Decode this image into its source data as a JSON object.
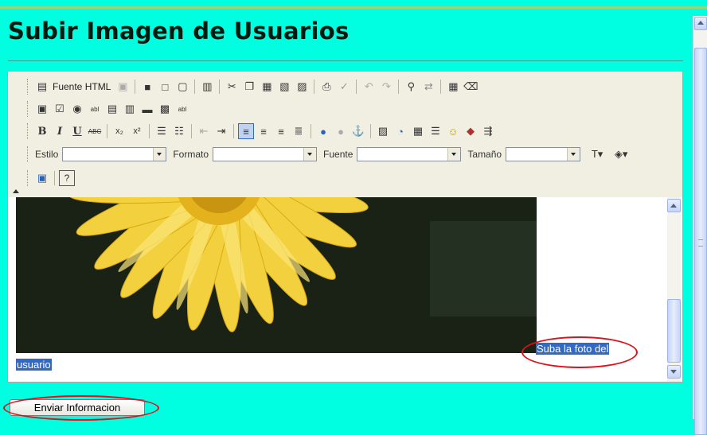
{
  "page": {
    "title": "Subir Imagen de Usuarios"
  },
  "toolbar": {
    "row1": {
      "source_label": "Fuente HTML"
    },
    "row4": {
      "style_label": "Estilo",
      "format_label": "Formato",
      "font_label": "Fuente",
      "size_label": "Tamaño",
      "style_value": "",
      "format_value": "",
      "font_value": "",
      "size_value": ""
    }
  },
  "content": {
    "selected_text_1": "Suba la foto del",
    "selected_text_2": "usuario"
  },
  "form": {
    "submit_label": "Enviar Informacion"
  },
  "colors": {
    "page_background": "#00FFE1",
    "selection": "#316AC5",
    "annotation": "#E0101A",
    "flower": "#F5D94A"
  }
}
